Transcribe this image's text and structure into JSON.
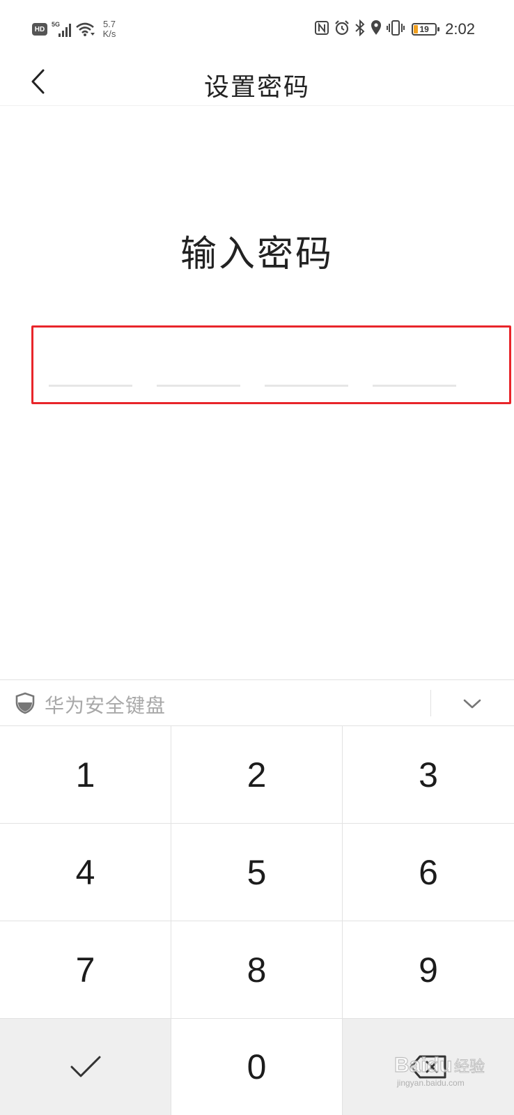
{
  "status_bar": {
    "hd_badge": "HD",
    "network_type": "5G",
    "net_speed_value": "5.7",
    "net_speed_unit": "K/s",
    "battery_level": "19",
    "battery_percent": 19,
    "time": "2:02",
    "icons": [
      "nfc-icon",
      "alarm-icon",
      "bluetooth-icon",
      "location-icon",
      "vibrate-icon"
    ]
  },
  "header": {
    "title": "设置密码",
    "back_icon": "chevron-left-icon"
  },
  "password": {
    "prompt": "输入密码",
    "slot_count": 4,
    "highlight_color": "#e8252a"
  },
  "keyboard": {
    "name": "华为安全键盘",
    "shield_icon": "shield-icon",
    "collapse_icon": "chevron-down-icon",
    "keys": [
      "1",
      "2",
      "3",
      "4",
      "5",
      "6",
      "7",
      "8",
      "9",
      "",
      "0",
      ""
    ],
    "confirm_icon": "checkmark-icon",
    "delete_icon": "backspace-icon"
  },
  "watermark": {
    "brand": "Baidu",
    "suffix": "经验",
    "url": "jingyan.baidu.com"
  }
}
